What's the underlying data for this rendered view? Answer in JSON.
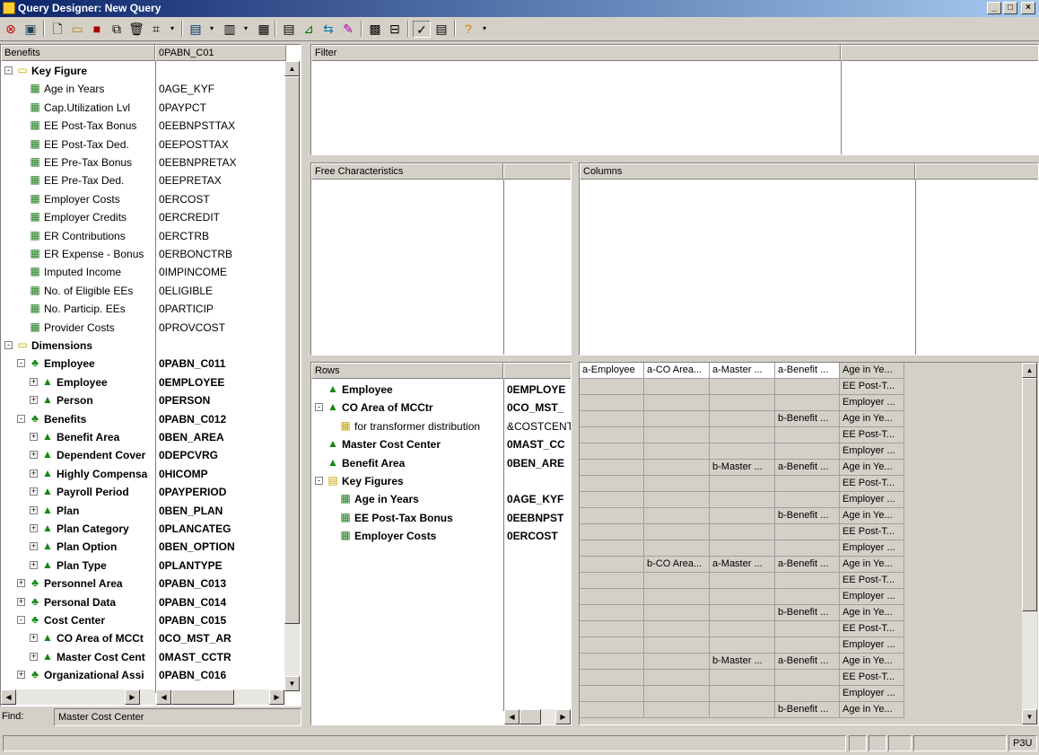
{
  "window": {
    "title": "Query Designer: New Query",
    "minimize": "_",
    "restore": "□",
    "close": "×"
  },
  "toolbar": {
    "icons": [
      "exit-icon",
      "query-info-icon",
      "new-icon",
      "open-icon",
      "save-icon",
      "copy-icon",
      "delete-icon",
      "tab-icon",
      "dropdown",
      "display-icon",
      "dropdown",
      "columns-icon",
      "dropdown",
      "grid-icon",
      "properties-icon",
      "filter-icon",
      "swap-icon",
      "variable-icon",
      "exception-icon",
      "condition-icon",
      "check-icon",
      "table-view-icon",
      "help-icon",
      "dropdown"
    ]
  },
  "left_tree": {
    "header": {
      "col1": "Benefits",
      "col2": "0PABN_C01"
    },
    "rows": [
      {
        "label": "Key Figure",
        "tech": "",
        "level": 0,
        "icon": "folder",
        "exp": "-",
        "bold": true
      },
      {
        "label": "Age in Years",
        "tech": "0AGE_KYF",
        "level": 1,
        "icon": "keyfig",
        "exp": "",
        "bold": false
      },
      {
        "label": "Cap.Utilization Lvl",
        "tech": "0PAYPCT",
        "level": 1,
        "icon": "keyfig",
        "exp": "",
        "bold": false
      },
      {
        "label": "EE Post-Tax Bonus",
        "tech": "0EEBNPSTTAX",
        "level": 1,
        "icon": "keyfig",
        "exp": "",
        "bold": false
      },
      {
        "label": "EE Post-Tax Ded.",
        "tech": "0EEPOSTTAX",
        "level": 1,
        "icon": "keyfig",
        "exp": "",
        "bold": false
      },
      {
        "label": "EE Pre-Tax Bonus",
        "tech": "0EEBNPRETAX",
        "level": 1,
        "icon": "keyfig",
        "exp": "",
        "bold": false
      },
      {
        "label": "EE Pre-Tax Ded.",
        "tech": "0EEPRETAX",
        "level": 1,
        "icon": "keyfig",
        "exp": "",
        "bold": false
      },
      {
        "label": "Employer Costs",
        "tech": "0ERCOST",
        "level": 1,
        "icon": "keyfig",
        "exp": "",
        "bold": false
      },
      {
        "label": "Employer Credits",
        "tech": "0ERCREDIT",
        "level": 1,
        "icon": "keyfig",
        "exp": "",
        "bold": false
      },
      {
        "label": "ER Contributions",
        "tech": "0ERCTRB",
        "level": 1,
        "icon": "keyfig",
        "exp": "",
        "bold": false
      },
      {
        "label": "ER Expense - Bonus",
        "tech": "0ERBONCTRB",
        "level": 1,
        "icon": "keyfig",
        "exp": "",
        "bold": false
      },
      {
        "label": "Imputed Income",
        "tech": "0IMPINCOME",
        "level": 1,
        "icon": "keyfig",
        "exp": "",
        "bold": false
      },
      {
        "label": "No. of Eligible EEs",
        "tech": "0ELIGIBLE",
        "level": 1,
        "icon": "keyfig",
        "exp": "",
        "bold": false
      },
      {
        "label": "No. Particip. EEs",
        "tech": "0PARTICIP",
        "level": 1,
        "icon": "keyfig",
        "exp": "",
        "bold": false
      },
      {
        "label": "Provider Costs",
        "tech": "0PROVCOST",
        "level": 1,
        "icon": "keyfig",
        "exp": "",
        "bold": false
      },
      {
        "label": "Dimensions",
        "tech": "",
        "level": 0,
        "icon": "folder",
        "exp": "-",
        "bold": true
      },
      {
        "label": "Employee",
        "tech": "0PABN_C011",
        "level": 1,
        "icon": "dim",
        "exp": "-",
        "bold": true
      },
      {
        "label": "Employee",
        "tech": "0EMPLOYEE",
        "level": 2,
        "icon": "char",
        "exp": "+",
        "bold": true
      },
      {
        "label": "Person",
        "tech": "0PERSON",
        "level": 2,
        "icon": "char",
        "exp": "+",
        "bold": true
      },
      {
        "label": "Benefits",
        "tech": "0PABN_C012",
        "level": 1,
        "icon": "dim",
        "exp": "-",
        "bold": true
      },
      {
        "label": "Benefit Area",
        "tech": "0BEN_AREA",
        "level": 2,
        "icon": "char",
        "exp": "+",
        "bold": true
      },
      {
        "label": "Dependent Cover",
        "tech": "0DEPCVRG",
        "level": 2,
        "icon": "char",
        "exp": "+",
        "bold": true
      },
      {
        "label": "Highly Compensa",
        "tech": "0HICOMP",
        "level": 2,
        "icon": "char",
        "exp": "+",
        "bold": true
      },
      {
        "label": "Payroll Period",
        "tech": "0PAYPERIOD",
        "level": 2,
        "icon": "char",
        "exp": "+",
        "bold": true
      },
      {
        "label": "Plan",
        "tech": "0BEN_PLAN",
        "level": 2,
        "icon": "char",
        "exp": "+",
        "bold": true
      },
      {
        "label": "Plan Category",
        "tech": "0PLANCATEG",
        "level": 2,
        "icon": "char",
        "exp": "+",
        "bold": true
      },
      {
        "label": "Plan Option",
        "tech": "0BEN_OPTION",
        "level": 2,
        "icon": "char",
        "exp": "+",
        "bold": true
      },
      {
        "label": "Plan Type",
        "tech": "0PLANTYPE",
        "level": 2,
        "icon": "char",
        "exp": "+",
        "bold": true
      },
      {
        "label": "Personnel Area",
        "tech": "0PABN_C013",
        "level": 1,
        "icon": "dim",
        "exp": "+",
        "bold": true
      },
      {
        "label": "Personal Data",
        "tech": "0PABN_C014",
        "level": 1,
        "icon": "dim",
        "exp": "+",
        "bold": true
      },
      {
        "label": "Cost Center",
        "tech": "0PABN_C015",
        "level": 1,
        "icon": "dim",
        "exp": "-",
        "bold": true
      },
      {
        "label": "CO Area of MCCt",
        "tech": "0CO_MST_AR",
        "level": 2,
        "icon": "char",
        "exp": "+",
        "bold": true
      },
      {
        "label": "Master Cost Cent",
        "tech": "0MAST_CCTR",
        "level": 2,
        "icon": "char",
        "exp": "+",
        "bold": true
      },
      {
        "label": "Organizational Assi",
        "tech": "0PABN_C016",
        "level": 1,
        "icon": "dim",
        "exp": "+",
        "bold": true
      }
    ]
  },
  "find": {
    "label": "Find:",
    "value": "Master Cost Center"
  },
  "filter_panel": {
    "header": "Filter"
  },
  "free_chars_panel": {
    "header": "Free Characteristics"
  },
  "columns_panel": {
    "header": "Columns"
  },
  "rows_panel": {
    "header": "Rows",
    "rows": [
      {
        "label": "Employee",
        "tech": "0EMPLOYE",
        "level": 0,
        "icon": "char",
        "exp": "",
        "bold": true
      },
      {
        "label": "CO Area of MCCtr",
        "tech": "0CO_MST_",
        "level": 0,
        "icon": "char",
        "exp": "-",
        "bold": true
      },
      {
        "label": "for transformer distribution",
        "tech": "&COSTCENT",
        "level": 1,
        "icon": "hier",
        "exp": "",
        "bold": false
      },
      {
        "label": "Master Cost Center",
        "tech": "0MAST_CC",
        "level": 0,
        "icon": "char",
        "exp": "",
        "bold": true
      },
      {
        "label": "Benefit Area",
        "tech": "0BEN_ARE",
        "level": 0,
        "icon": "char",
        "exp": "",
        "bold": true
      },
      {
        "label": "Key Figures",
        "tech": "",
        "level": 0,
        "icon": "kfs",
        "exp": "-",
        "bold": true
      },
      {
        "label": "Age in Years",
        "tech": "0AGE_KYF",
        "level": 1,
        "icon": "keyfig",
        "exp": "",
        "bold": true
      },
      {
        "label": "EE Post-Tax Bonus",
        "tech": "0EEBNPST",
        "level": 1,
        "icon": "keyfig",
        "exp": "",
        "bold": true
      },
      {
        "label": "Employer Costs",
        "tech": "0ERCOST",
        "level": 1,
        "icon": "keyfig",
        "exp": "",
        "bold": true
      }
    ]
  },
  "preview": {
    "headers": [
      "a-Employee",
      "a-CO Area...",
      "a-Master ...",
      "a-Benefit ...",
      "Age in Ye..."
    ],
    "rows": [
      [
        "",
        "",
        "",
        "",
        "EE Post-T..."
      ],
      [
        "",
        "",
        "",
        "",
        "Employer ..."
      ],
      [
        "",
        "",
        "",
        "b-Benefit ...",
        "Age in Ye..."
      ],
      [
        "",
        "",
        "",
        "",
        "EE Post-T..."
      ],
      [
        "",
        "",
        "",
        "",
        "Employer ..."
      ],
      [
        "",
        "",
        "b-Master ...",
        "a-Benefit ...",
        "Age in Ye..."
      ],
      [
        "",
        "",
        "",
        "",
        "EE Post-T..."
      ],
      [
        "",
        "",
        "",
        "",
        "Employer ..."
      ],
      [
        "",
        "",
        "",
        "b-Benefit ...",
        "Age in Ye..."
      ],
      [
        "",
        "",
        "",
        "",
        "EE Post-T..."
      ],
      [
        "",
        "",
        "",
        "",
        "Employer ..."
      ],
      [
        "",
        "b-CO Area...",
        "a-Master ...",
        "a-Benefit ...",
        "Age in Ye..."
      ],
      [
        "",
        "",
        "",
        "",
        "EE Post-T..."
      ],
      [
        "",
        "",
        "",
        "",
        "Employer ..."
      ],
      [
        "",
        "",
        "",
        "b-Benefit ...",
        "Age in Ye..."
      ],
      [
        "",
        "",
        "",
        "",
        "EE Post-T..."
      ],
      [
        "",
        "",
        "",
        "",
        "Employer ..."
      ],
      [
        "",
        "",
        "b-Master ...",
        "a-Benefit ...",
        "Age in Ye..."
      ],
      [
        "",
        "",
        "",
        "",
        "EE Post-T..."
      ],
      [
        "",
        "",
        "",
        "",
        "Employer ..."
      ],
      [
        "",
        "",
        "",
        "b-Benefit ...",
        "Age in Ye..."
      ]
    ]
  },
  "status": {
    "server": "P3U"
  }
}
